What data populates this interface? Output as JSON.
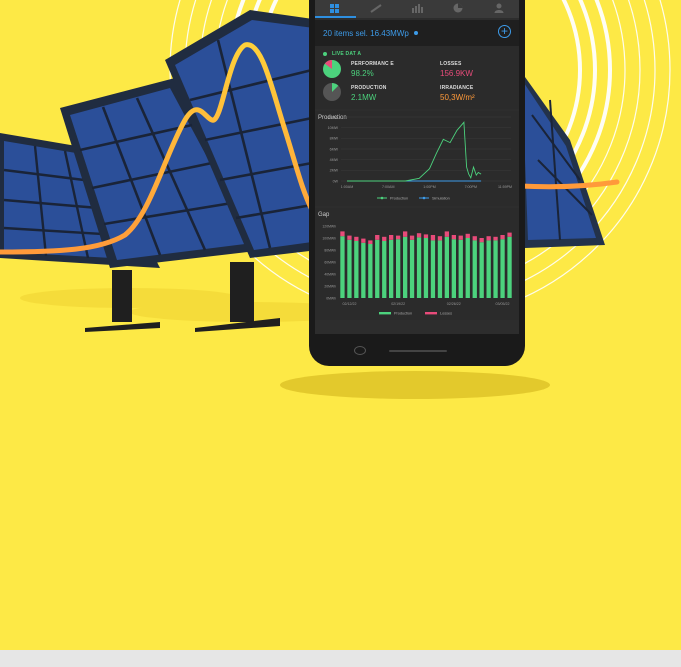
{
  "colors": {
    "background": "#fde946",
    "accent_blue": "#3d9be9",
    "production_green": "#4cd27d",
    "losses_pink": "#e84b7a",
    "curve_orange": "#ffa43a",
    "curve_yellow": "#ffd03a"
  },
  "tabs": [
    {
      "icon": "dashboard-grid-icon",
      "active": true
    },
    {
      "icon": "satellite-icon",
      "active": false
    },
    {
      "icon": "bar-chart-icon",
      "active": false
    },
    {
      "icon": "pie-chart-icon",
      "active": false
    },
    {
      "icon": "user-icon",
      "active": false
    }
  ],
  "selection": {
    "text": "20 items sel. 16.43MWp",
    "add_icon": "plus-circle-icon"
  },
  "live": {
    "title": "LIVE DAT  A",
    "performance": {
      "label": "PERFORMANC  E",
      "value": "98.2%"
    },
    "losses": {
      "label": "LOSSES",
      "value": "156.9KW"
    },
    "production": {
      "label": "PRODUCTION",
      "value": "2.1MW"
    },
    "irradiance": {
      "label": "IRRADIANCE",
      "value": "50,3W/m²"
    }
  },
  "chart_data": [
    {
      "type": "line",
      "title": "Production",
      "y_ticks": [
        "12MW",
        "10MW",
        "8MW",
        "6MW",
        "4MW",
        "2MW",
        "0W"
      ],
      "x_ticks": [
        "1:00AM",
        "7:00AM",
        "1:00PM",
        "7:00PM",
        "11:59PM"
      ],
      "ylim": [
        0,
        12
      ],
      "x_hours": [
        1,
        7,
        9.5,
        11.5,
        13,
        14,
        15,
        16,
        17,
        18,
        18.4,
        18.7,
        19,
        19.4,
        19.8,
        20.1,
        20.5
      ],
      "series": [
        {
          "name": "Production",
          "values": [
            0,
            0,
            0,
            0.5,
            2.3,
            5.2,
            7.8,
            7.2,
            9.5,
            11,
            2.6,
            1.3,
            0.6,
            2.6,
            1.1,
            1.6,
            1.3
          ]
        },
        {
          "name": "Simulation",
          "values": [
            0,
            0,
            0,
            0,
            0,
            0,
            0,
            0,
            0,
            0,
            0,
            0,
            0,
            0,
            0,
            0,
            0
          ]
        }
      ]
    },
    {
      "type": "bar",
      "title": "Gap",
      "y_ticks": [
        "120MWh",
        "100MWh",
        "80MWh",
        "60MWh",
        "40MWh",
        "20MWh",
        "0MWh"
      ],
      "x_ticks": [
        "02/12/22",
        "02/19/22",
        "02/26/22",
        "03/05/22"
      ],
      "ylim": [
        0,
        120
      ],
      "series": [
        {
          "name": "Production",
          "values": [
            103,
            97,
            95,
            92,
            90,
            97,
            95,
            97,
            98,
            102,
            97,
            101,
            100,
            96,
            96,
            102,
            98,
            97,
            100,
            96,
            93,
            96,
            96,
            98,
            102
          ]
        },
        {
          "name": "Losses",
          "values": [
            8,
            7,
            7,
            7,
            6,
            8,
            7,
            8,
            6,
            9,
            7,
            7,
            6,
            9,
            7,
            9,
            7,
            7,
            7,
            7,
            7,
            7,
            6,
            7,
            7
          ]
        }
      ]
    }
  ]
}
